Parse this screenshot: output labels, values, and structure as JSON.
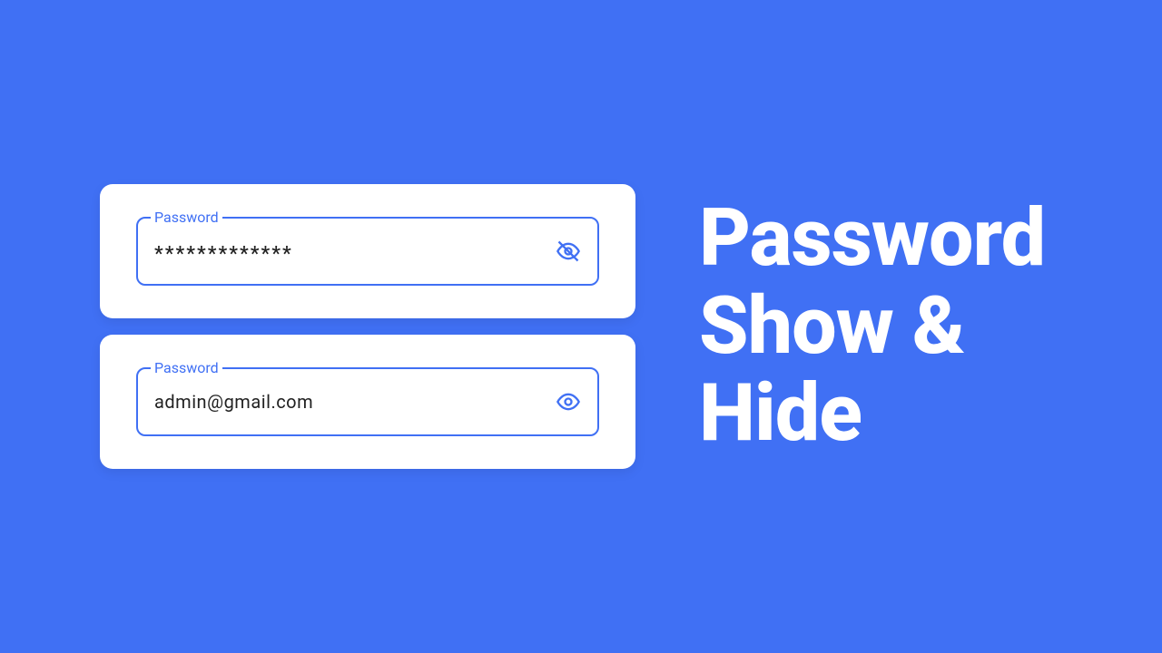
{
  "colors": {
    "primary": "#4070f4",
    "card_bg": "#ffffff",
    "text": "#222222"
  },
  "fields": {
    "hidden": {
      "label": "Password",
      "value": "*************"
    },
    "shown": {
      "label": "Password",
      "value": "admin@gmail.com"
    }
  },
  "title": {
    "line1": "Password",
    "line2": "Show &",
    "line3": "Hide"
  }
}
